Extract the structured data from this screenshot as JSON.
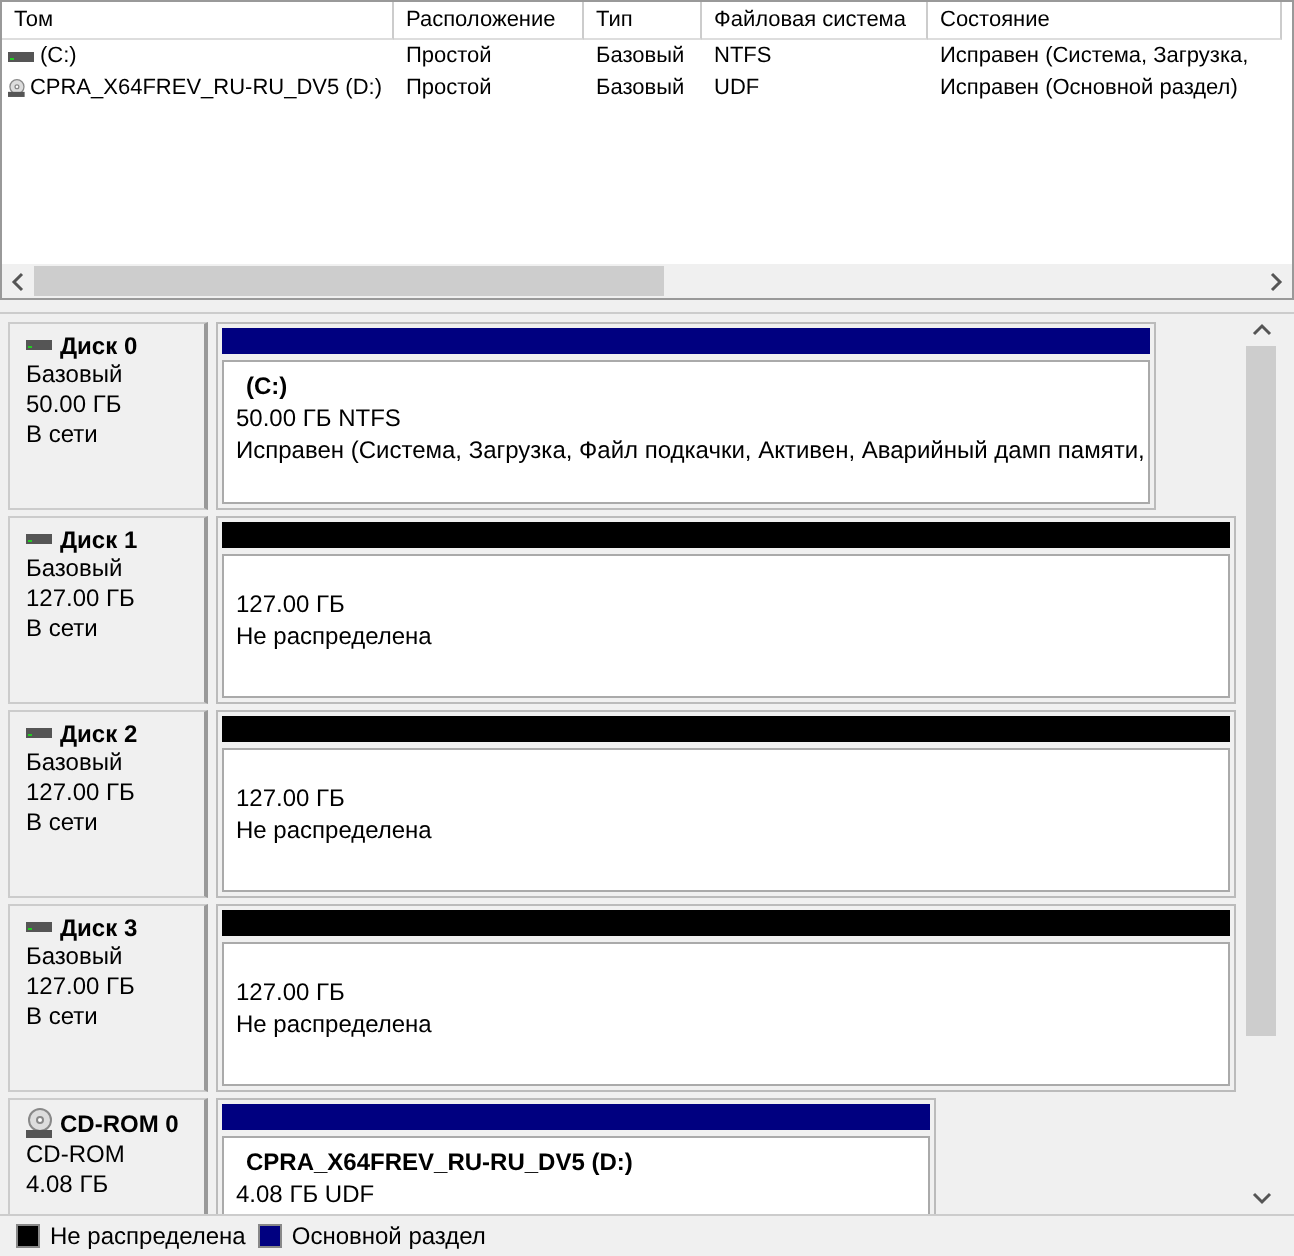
{
  "volume_table": {
    "columns": [
      "Том",
      "Расположение",
      "Тип",
      "Файловая система",
      "Состояние"
    ],
    "rows": [
      {
        "kind": "hdd",
        "cells": [
          "(C:)",
          "Простой",
          "Базовый",
          "NTFS",
          "Исправен (Система, Загрузка,"
        ]
      },
      {
        "kind": "cdrom",
        "cells": [
          "CPRA_X64FREV_RU-RU_DV5 (D:)",
          "Простой",
          "Базовый",
          "UDF",
          "Исправен (Основной раздел)"
        ]
      }
    ]
  },
  "disks": [
    {
      "kind": "hdd",
      "name": "Диск 0",
      "type": "Базовый",
      "size": "50.00 ГБ",
      "status": "В сети",
      "partition": {
        "kind": "primary",
        "title": "(C:)",
        "size": "50.00 ГБ NTFS",
        "status": "Исправен (Система, Загрузка, Файл подкачки, Активен, Аварийный дамп памяти,"
      }
    },
    {
      "kind": "hdd",
      "name": "Диск 1",
      "type": "Базовый",
      "size": "127.00 ГБ",
      "status": "В сети",
      "partition": {
        "kind": "unallocated",
        "size": "127.00 ГБ",
        "status": "Не распределена"
      }
    },
    {
      "kind": "hdd",
      "name": "Диск 2",
      "type": "Базовый",
      "size": "127.00 ГБ",
      "status": "В сети",
      "partition": {
        "kind": "unallocated",
        "size": "127.00 ГБ",
        "status": "Не распределена"
      }
    },
    {
      "kind": "hdd",
      "name": "Диск 3",
      "type": "Базовый",
      "size": "127.00 ГБ",
      "status": "В сети",
      "partition": {
        "kind": "unallocated",
        "size": "127.00 ГБ",
        "status": "Не распределена"
      }
    },
    {
      "kind": "cdrom",
      "name": "CD-ROM 0",
      "type": "CD-ROM",
      "size": "4.08 ГБ",
      "partition": {
        "kind": "primary",
        "title": "CPRA_X64FREV_RU-RU_DV5  (D:)",
        "size": "4.08 ГБ UDF"
      }
    }
  ],
  "legend": [
    {
      "kind": "unallocated",
      "label": "Не распределена"
    },
    {
      "kind": "primary",
      "label": "Основной раздел"
    }
  ]
}
